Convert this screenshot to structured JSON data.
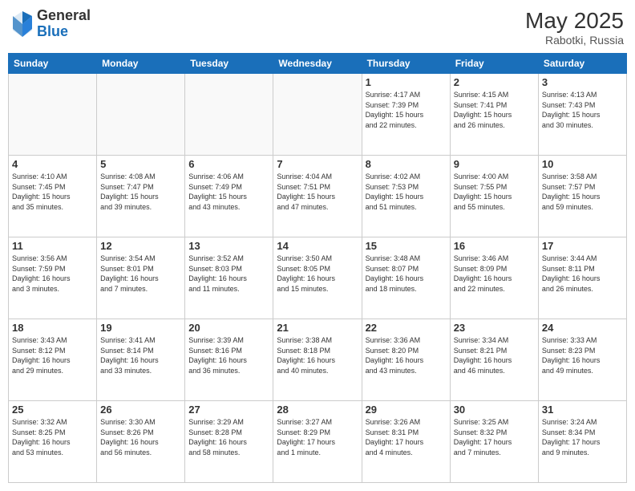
{
  "header": {
    "logo_general": "General",
    "logo_blue": "Blue",
    "month_year": "May 2025",
    "location": "Rabotki, Russia"
  },
  "days_of_week": [
    "Sunday",
    "Monday",
    "Tuesday",
    "Wednesday",
    "Thursday",
    "Friday",
    "Saturday"
  ],
  "weeks": [
    [
      {
        "day": "",
        "info": ""
      },
      {
        "day": "",
        "info": ""
      },
      {
        "day": "",
        "info": ""
      },
      {
        "day": "",
        "info": ""
      },
      {
        "day": "1",
        "info": "Sunrise: 4:17 AM\nSunset: 7:39 PM\nDaylight: 15 hours\nand 22 minutes."
      },
      {
        "day": "2",
        "info": "Sunrise: 4:15 AM\nSunset: 7:41 PM\nDaylight: 15 hours\nand 26 minutes."
      },
      {
        "day": "3",
        "info": "Sunrise: 4:13 AM\nSunset: 7:43 PM\nDaylight: 15 hours\nand 30 minutes."
      }
    ],
    [
      {
        "day": "4",
        "info": "Sunrise: 4:10 AM\nSunset: 7:45 PM\nDaylight: 15 hours\nand 35 minutes."
      },
      {
        "day": "5",
        "info": "Sunrise: 4:08 AM\nSunset: 7:47 PM\nDaylight: 15 hours\nand 39 minutes."
      },
      {
        "day": "6",
        "info": "Sunrise: 4:06 AM\nSunset: 7:49 PM\nDaylight: 15 hours\nand 43 minutes."
      },
      {
        "day": "7",
        "info": "Sunrise: 4:04 AM\nSunset: 7:51 PM\nDaylight: 15 hours\nand 47 minutes."
      },
      {
        "day": "8",
        "info": "Sunrise: 4:02 AM\nSunset: 7:53 PM\nDaylight: 15 hours\nand 51 minutes."
      },
      {
        "day": "9",
        "info": "Sunrise: 4:00 AM\nSunset: 7:55 PM\nDaylight: 15 hours\nand 55 minutes."
      },
      {
        "day": "10",
        "info": "Sunrise: 3:58 AM\nSunset: 7:57 PM\nDaylight: 15 hours\nand 59 minutes."
      }
    ],
    [
      {
        "day": "11",
        "info": "Sunrise: 3:56 AM\nSunset: 7:59 PM\nDaylight: 16 hours\nand 3 minutes."
      },
      {
        "day": "12",
        "info": "Sunrise: 3:54 AM\nSunset: 8:01 PM\nDaylight: 16 hours\nand 7 minutes."
      },
      {
        "day": "13",
        "info": "Sunrise: 3:52 AM\nSunset: 8:03 PM\nDaylight: 16 hours\nand 11 minutes."
      },
      {
        "day": "14",
        "info": "Sunrise: 3:50 AM\nSunset: 8:05 PM\nDaylight: 16 hours\nand 15 minutes."
      },
      {
        "day": "15",
        "info": "Sunrise: 3:48 AM\nSunset: 8:07 PM\nDaylight: 16 hours\nand 18 minutes."
      },
      {
        "day": "16",
        "info": "Sunrise: 3:46 AM\nSunset: 8:09 PM\nDaylight: 16 hours\nand 22 minutes."
      },
      {
        "day": "17",
        "info": "Sunrise: 3:44 AM\nSunset: 8:11 PM\nDaylight: 16 hours\nand 26 minutes."
      }
    ],
    [
      {
        "day": "18",
        "info": "Sunrise: 3:43 AM\nSunset: 8:12 PM\nDaylight: 16 hours\nand 29 minutes."
      },
      {
        "day": "19",
        "info": "Sunrise: 3:41 AM\nSunset: 8:14 PM\nDaylight: 16 hours\nand 33 minutes."
      },
      {
        "day": "20",
        "info": "Sunrise: 3:39 AM\nSunset: 8:16 PM\nDaylight: 16 hours\nand 36 minutes."
      },
      {
        "day": "21",
        "info": "Sunrise: 3:38 AM\nSunset: 8:18 PM\nDaylight: 16 hours\nand 40 minutes."
      },
      {
        "day": "22",
        "info": "Sunrise: 3:36 AM\nSunset: 8:20 PM\nDaylight: 16 hours\nand 43 minutes."
      },
      {
        "day": "23",
        "info": "Sunrise: 3:34 AM\nSunset: 8:21 PM\nDaylight: 16 hours\nand 46 minutes."
      },
      {
        "day": "24",
        "info": "Sunrise: 3:33 AM\nSunset: 8:23 PM\nDaylight: 16 hours\nand 49 minutes."
      }
    ],
    [
      {
        "day": "25",
        "info": "Sunrise: 3:32 AM\nSunset: 8:25 PM\nDaylight: 16 hours\nand 53 minutes."
      },
      {
        "day": "26",
        "info": "Sunrise: 3:30 AM\nSunset: 8:26 PM\nDaylight: 16 hours\nand 56 minutes."
      },
      {
        "day": "27",
        "info": "Sunrise: 3:29 AM\nSunset: 8:28 PM\nDaylight: 16 hours\nand 58 minutes."
      },
      {
        "day": "28",
        "info": "Sunrise: 3:27 AM\nSunset: 8:29 PM\nDaylight: 17 hours\nand 1 minute."
      },
      {
        "day": "29",
        "info": "Sunrise: 3:26 AM\nSunset: 8:31 PM\nDaylight: 17 hours\nand 4 minutes."
      },
      {
        "day": "30",
        "info": "Sunrise: 3:25 AM\nSunset: 8:32 PM\nDaylight: 17 hours\nand 7 minutes."
      },
      {
        "day": "31",
        "info": "Sunrise: 3:24 AM\nSunset: 8:34 PM\nDaylight: 17 hours\nand 9 minutes."
      }
    ]
  ]
}
